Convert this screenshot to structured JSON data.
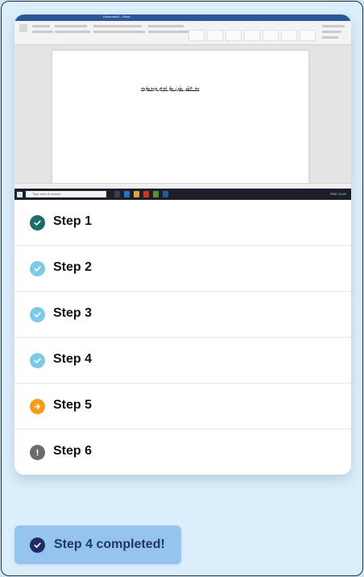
{
  "preview": {
    "window_title": "Document1 - Word",
    "document_text": "بە خێر بێن بۆ ئەم ویدیۆیە",
    "search_placeholder": "Type here to search",
    "tray_text": "ENG 12:41"
  },
  "steps": [
    {
      "label": "Step 1",
      "state": "done",
      "icon": "check-icon",
      "color": "#1e6b6b"
    },
    {
      "label": "Step 2",
      "state": "complete",
      "icon": "check-icon",
      "color": "#7ec8e8"
    },
    {
      "label": "Step 3",
      "state": "complete",
      "icon": "check-icon",
      "color": "#7ec8e8"
    },
    {
      "label": "Step 4",
      "state": "complete",
      "icon": "check-icon",
      "color": "#7ec8e8"
    },
    {
      "label": "Step 5",
      "state": "current",
      "icon": "arrow-right-icon",
      "color": "#f59a1b"
    },
    {
      "label": "Step 6",
      "state": "error",
      "icon": "exclamation-icon",
      "color": "#6c6c6c"
    }
  ],
  "toast": {
    "message": "Step 4 completed!",
    "icon": "check-icon",
    "background": "#93c3ee"
  }
}
